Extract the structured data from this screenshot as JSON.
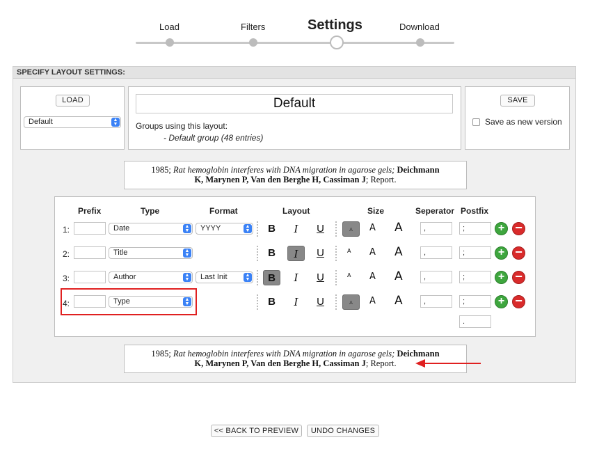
{
  "stepper": {
    "steps": [
      "Load",
      "Filters",
      "Settings",
      "Download"
    ],
    "active": "Settings"
  },
  "panel": {
    "title": "SPECIFY LAYOUT SETTINGS:"
  },
  "left_box": {
    "load_label": "LOAD",
    "layout_select": "Default"
  },
  "center_box": {
    "layout_name": "Default",
    "groups_label": "Groups using this layout:",
    "group_entry": "- Default group (48 entries)"
  },
  "right_box": {
    "save_label": "SAVE",
    "save_new_label": "Save as new version",
    "save_new_checked": false
  },
  "citation_top": {
    "year": "1985;",
    "title": "Rat hemoglobin interferes with DNA migration in agarose gels;",
    "authors_line1": "Deichmann",
    "authors_line2": "K, Marynen P, Van den Berghe H, Cassiman J",
    "type": "; Report."
  },
  "citation_bottom": {
    "year": "1985;",
    "title": "Rat hemoglobin interferes with DNA migration in agarose gels;",
    "authors_line1": "Deichmann",
    "authors_line2": "K, Marynen P, Van den Berghe H, Cassiman J",
    "type": "; Report."
  },
  "table": {
    "headers": {
      "prefix": "Prefix",
      "type": "Type",
      "format": "Format",
      "layout": "Layout",
      "size": "Size",
      "separator": "Seperator",
      "postfix": "Postfix"
    },
    "rows": [
      {
        "num": "1:",
        "prefix": "",
        "type": "Date",
        "format": "YYYY",
        "bold": false,
        "italic": false,
        "underline": false,
        "separator": ",",
        "postfix": ";"
      },
      {
        "num": "2:",
        "prefix": "",
        "type": "Title",
        "format": "",
        "bold": false,
        "italic": true,
        "underline": false,
        "separator": ",",
        "postfix": ";"
      },
      {
        "num": "3:",
        "prefix": "",
        "type": "Author",
        "format": "Last Init",
        "bold": true,
        "italic": false,
        "underline": false,
        "separator": ",",
        "postfix": ";"
      },
      {
        "num": "4:",
        "prefix": "",
        "type": "Type",
        "format": "",
        "bold": false,
        "italic": false,
        "underline": false,
        "separator": ",",
        "postfix": ";"
      }
    ],
    "final_postfix": ".",
    "style_glyphs": {
      "bold": "B",
      "italic": "I",
      "underline": "U",
      "size": "A"
    }
  },
  "footer": {
    "back_label": "<< BACK TO PREVIEW",
    "undo_label": "UNDO CHANGES"
  },
  "colors": {
    "highlight_red": "#e02020",
    "accent_blue": "#3b82f6",
    "plus_green": "#3ea63e",
    "minus_red": "#d92b2b"
  }
}
